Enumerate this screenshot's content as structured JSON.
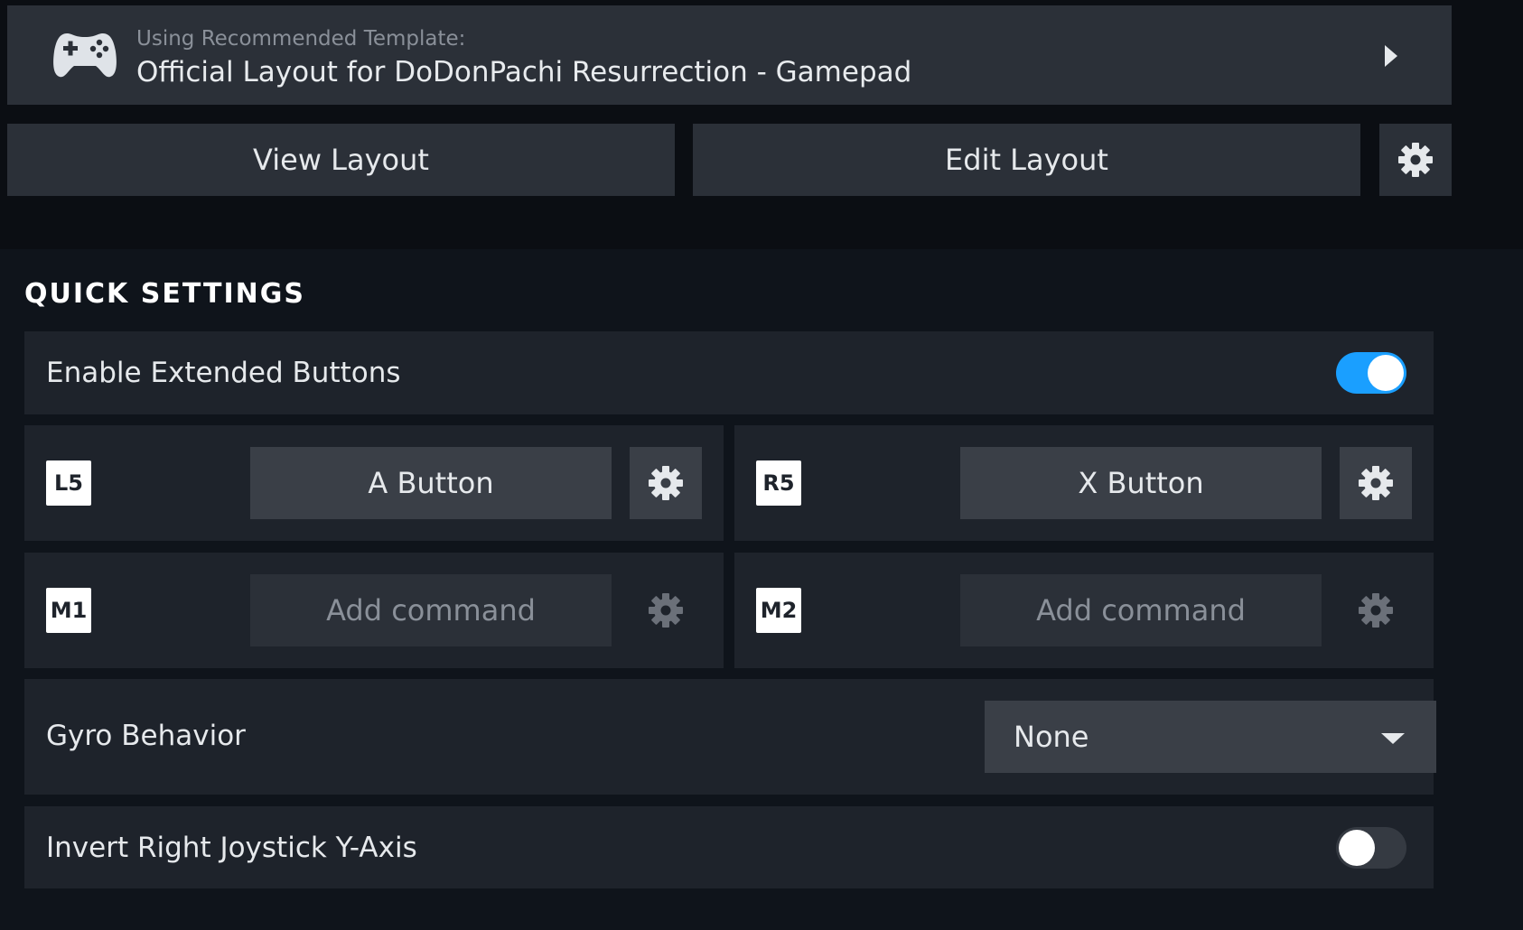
{
  "template": {
    "caption": "Using Recommended Template:",
    "name": "Official Layout for DoDonPachi Resurrection - Gamepad",
    "icon": "gamepad-icon"
  },
  "actions": {
    "view_label": "View Layout",
    "edit_label": "Edit Layout"
  },
  "quick_settings": {
    "title": "QUICK SETTINGS",
    "extended_buttons": {
      "label": "Enable Extended Buttons",
      "enabled": true
    },
    "bindings": [
      {
        "badge": "L5",
        "command": "A Button",
        "assigned": true
      },
      {
        "badge": "R5",
        "command": "X Button",
        "assigned": true
      },
      {
        "badge": "M1",
        "command": "Add command",
        "assigned": false
      },
      {
        "badge": "M2",
        "command": "Add command",
        "assigned": false
      }
    ],
    "gyro": {
      "label": "Gyro Behavior",
      "value": "None"
    },
    "invert_right_y": {
      "label": "Invert Right Joystick Y-Axis",
      "enabled": false
    }
  },
  "colors": {
    "accent": "#1a9fff",
    "panel": "#1e232b",
    "button": "#3a3f47"
  }
}
